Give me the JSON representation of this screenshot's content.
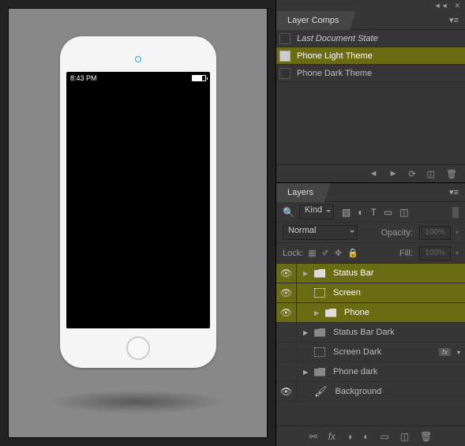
{
  "canvas": {
    "statusbar_time": "8:43 PM"
  },
  "layerComps": {
    "title": "Layer Comps",
    "items": [
      {
        "label": "Last Document State",
        "italic": true,
        "selected": false
      },
      {
        "label": "Phone Light Theme",
        "italic": false,
        "selected": true
      },
      {
        "label": "Phone Dark Theme",
        "italic": false,
        "selected": false
      }
    ]
  },
  "layersPanel": {
    "title": "Layers",
    "filterKind": "Kind",
    "blendMode": "Normal",
    "opacityLabel": "Opacity:",
    "opacityValue": "100%",
    "lockLabel": "Lock:",
    "fillLabel": "Fill:",
    "fillValue": "100%"
  },
  "layers": [
    {
      "name": "Status Bar",
      "visible": true,
      "type": "folder",
      "selected": true,
      "indent": 0,
      "arrow": true
    },
    {
      "name": "Screen",
      "visible": true,
      "type": "artboard",
      "selected": true,
      "indent": 0,
      "arrow": false
    },
    {
      "name": "Phone",
      "visible": true,
      "type": "folder",
      "selected": true,
      "indent": 1,
      "arrow": true
    },
    {
      "name": "Status Bar Dark",
      "visible": false,
      "type": "folder",
      "selected": false,
      "indent": 0,
      "arrow": true
    },
    {
      "name": "Screen Dark",
      "visible": false,
      "type": "artboard",
      "selected": false,
      "indent": 0,
      "arrow": false,
      "fx": true
    },
    {
      "name": "Phone dark",
      "visible": false,
      "type": "folder",
      "selected": false,
      "indent": 0,
      "arrow": true
    },
    {
      "name": "Background",
      "visible": true,
      "type": "brush",
      "selected": false,
      "indent": 0,
      "arrow": false
    }
  ],
  "fxLabel": "fx"
}
